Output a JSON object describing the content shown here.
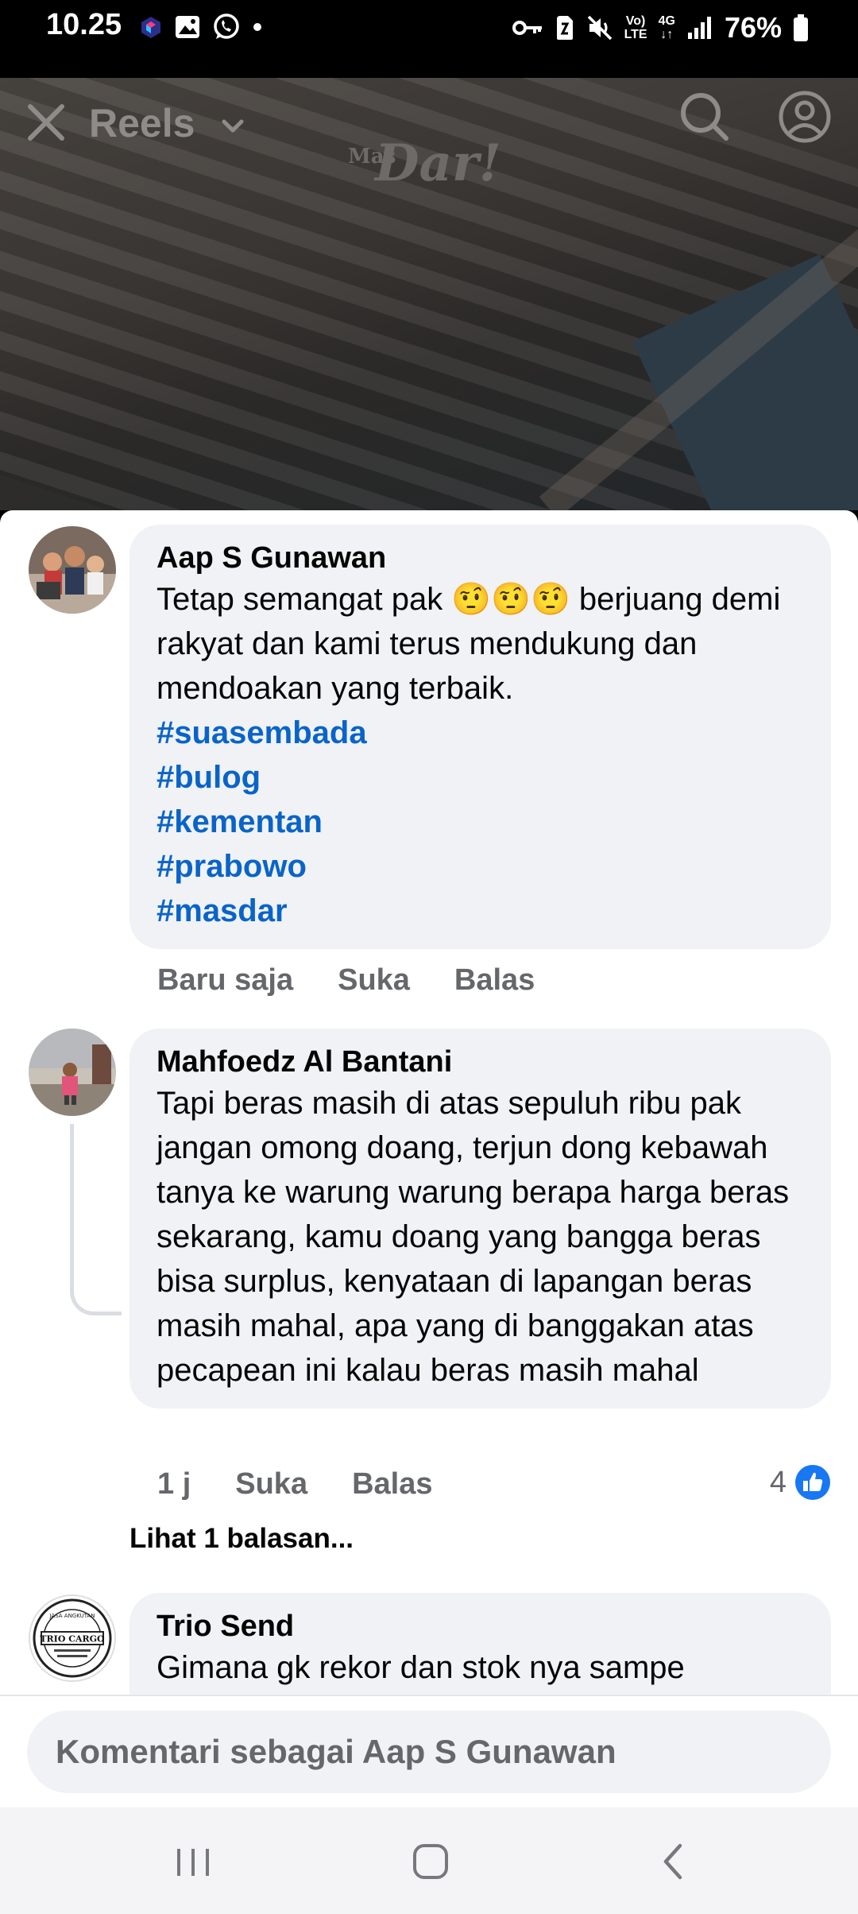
{
  "status_bar": {
    "time": "10.25",
    "battery": "76%",
    "network_top": "Vo)",
    "network_bottom": "LTE",
    "gen_top": "4G",
    "gen_bottom": "↓↑",
    "icons_left": [
      "app-notification-icon",
      "gallery-icon",
      "whatsapp-icon",
      "dot-icon"
    ],
    "icons_right": [
      "vpn-key-icon",
      "sim-icon",
      "mute-icon",
      "volte-icon",
      "4g-icon",
      "signal-icon",
      "battery-icon"
    ]
  },
  "header": {
    "title": "Reels",
    "watermark_small": "Mas",
    "watermark_big": "Dar!"
  },
  "comments": [
    {
      "author": "Aap S Gunawan",
      "text": "Tetap semangat pak 🤨🤨🤨 berjuang demi rakyat dan kami terus mendukung dan mendoakan yang terbaik.",
      "hashtags": [
        "#suasembada",
        "#bulog",
        "#kementan",
        "#prabowo",
        "#masdar"
      ],
      "time": "Baru saja",
      "like_label": "Suka",
      "reply_label": "Balas"
    },
    {
      "author": "Mahfoedz Al Bantani",
      "text": "Tapi beras masih di atas sepuluh ribu pak jangan omong doang, terjun dong kebawah tanya ke warung warung berapa harga beras sekarang, kamu doang yang bangga beras bisa surplus, kenyataan di lapangan beras masih mahal, apa yang di banggakan atas pecapean ini kalau beras masih mahal",
      "time": "1 j",
      "like_label": "Suka",
      "reply_label": "Balas",
      "like_count": "4",
      "view_replies": "Lihat 1 balasan..."
    },
    {
      "author": "Trio Send",
      "text": "Gimana gk rekor dan stok nya sampe",
      "avatar_text_top": "JASA ANGKUTAN",
      "avatar_text_main": "TRIO CARGO"
    }
  ],
  "composer": {
    "placeholder": "Komentari sebagai Aap S Gunawan"
  },
  "colors": {
    "hashtag": "#0a64c8",
    "bubble": "#f0f2f5",
    "meta_text": "#65676b",
    "like_badge": "#1877f2"
  }
}
